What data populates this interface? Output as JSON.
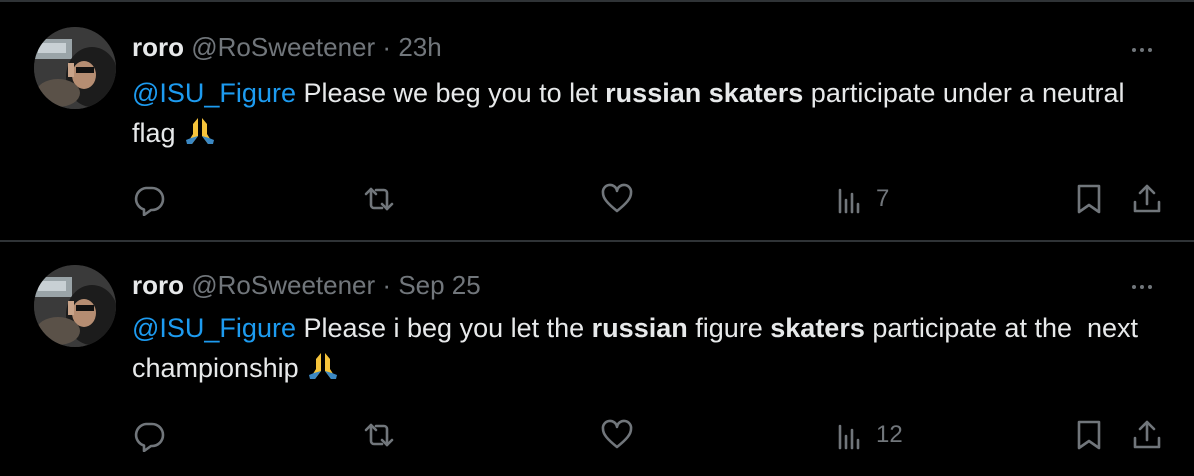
{
  "tweets": [
    {
      "name": "roro",
      "handle": "@RoSweetener",
      "separator": "·",
      "time": "23h",
      "text": {
        "mention": "@ISU_Figure",
        "part1": " Please we beg you to let ",
        "bold1": "russian skaters",
        "part2": " participate under a neutral flag ",
        "emoji": "folded-hands-emoji"
      },
      "views": "7"
    },
    {
      "name": "roro",
      "handle": "@RoSweetener",
      "separator": "·",
      "time": "Sep 25",
      "text": {
        "mention": "@ISU_Figure",
        "part1": " Please i beg you let the ",
        "bold1": "russian",
        "part2": " figure ",
        "bold2": "skaters",
        "part3": " participate at the  next championship ",
        "emoji": "folded-hands-emoji"
      },
      "views": "12"
    }
  ],
  "icons": {
    "reply": "reply-icon",
    "retweet": "retweet-icon",
    "like": "heart-icon",
    "views": "views-chart-icon",
    "bookmark": "bookmark-icon",
    "share": "share-icon",
    "more": "more-dots-icon"
  },
  "colors": {
    "background": "#000000",
    "text": "#e7e9ea",
    "secondary": "#71767b",
    "mention": "#1d9bf0",
    "divider": "#2f3336"
  }
}
